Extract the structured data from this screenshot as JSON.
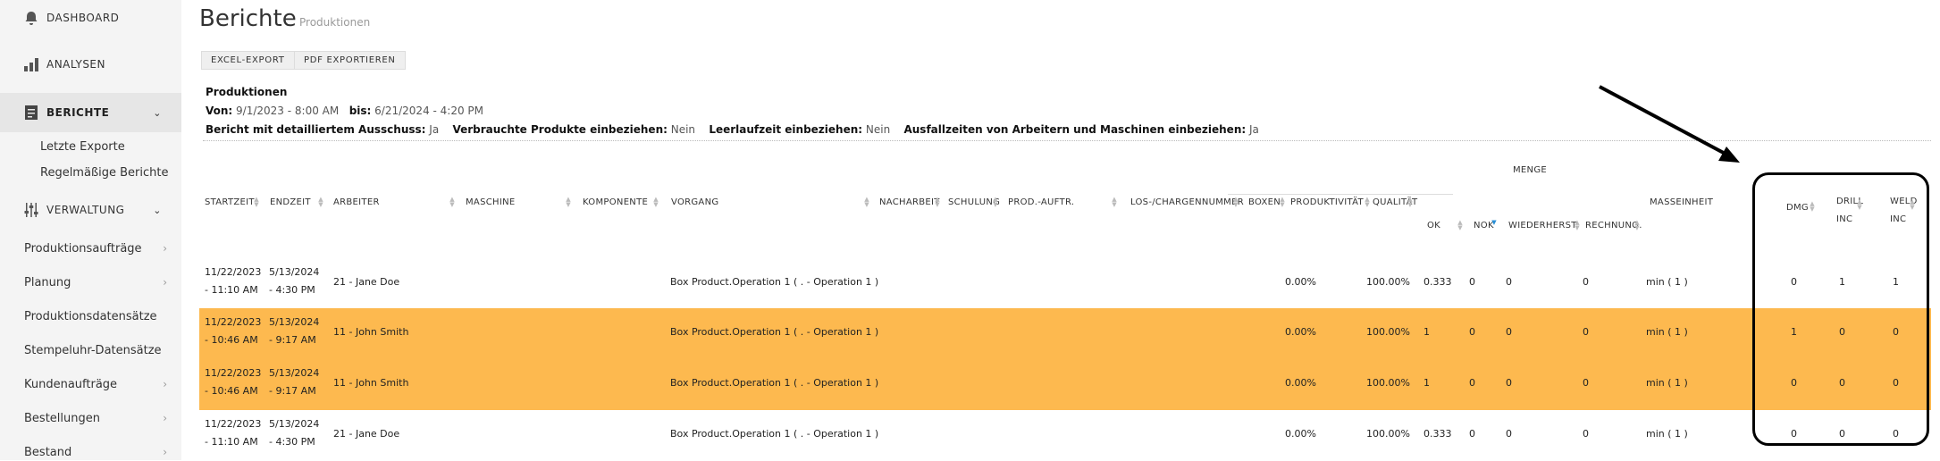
{
  "sidebar": {
    "dashboard": "DASHBOARD",
    "analysen": "ANALYSEN",
    "berichte": "BERICHTE",
    "berichte_sub": [
      "Letzte Exporte",
      "Regelmäßige Berichte"
    ],
    "verwaltung": "VERWALTUNG",
    "items": [
      "Produktionsaufträge",
      "Planung",
      "Produktionsdatensätze",
      "Stempeluhr-Datensätze",
      "Kundenaufträge",
      "Bestellungen",
      "Bestand"
    ]
  },
  "header": {
    "title": "Berichte",
    "subtitle": "Produktionen"
  },
  "toolbar": {
    "excel": "EXCEL-EXPORT",
    "pdf": "PDF EXPORTIEREN"
  },
  "info": {
    "heading": "Produktionen",
    "von_label": "Von:",
    "von": "9/1/2023 - 8:00 AM",
    "bis_label": "bis:",
    "bis": "6/21/2024 - 4:20 PM",
    "opt1_label": "Bericht mit detailliertem Ausschuss:",
    "opt1": "Ja",
    "opt2_label": "Verbrauchte Produkte einbeziehen:",
    "opt2": "Nein",
    "opt3_label": "Leerlaufzeit einbeziehen:",
    "opt3": "Nein",
    "opt4_label": "Ausfallzeiten von Arbeitern und Maschinen einbeziehen:",
    "opt4": "Ja"
  },
  "table": {
    "group_menge": "MENGE",
    "columns": {
      "startzeit": "STARTZEIT",
      "endzeit": "ENDZEIT",
      "arbeiter": "ARBEITER",
      "maschine": "MASCHINE",
      "komponente": "KOMPONENTE",
      "vorgang": "VORGANG",
      "nacharbeit": "NACHARBEIT",
      "schulung": "SCHULUNG",
      "prod_auftr": "PROD.-AUFTR.",
      "los": "LOS-/CHARGENNUMMER",
      "boxen": "BOXEN",
      "produktivitaet": "PRODUKTIVITÄT",
      "qualitaet": "QUALITÄT",
      "ok": "OK",
      "nok": "NOK",
      "wiederherst": "WIEDERHERST.",
      "rechnung": "RECHNUNG.",
      "masseinheit": "MASSEINHEIT",
      "dmg": "DMG",
      "drill_1": "DRILL",
      "drill_2": "INC",
      "weld_1": "WELD",
      "weld_2": "INC"
    },
    "rows": [
      {
        "start1": "11/22/2023",
        "start2": "- 11:10 AM",
        "end1": "5/13/2024",
        "end2": "- 4:30 PM",
        "arbeiter": "21 - Jane Doe",
        "vorgang": "Box Product.Operation 1 ( . - Operation 1 )",
        "prod": "0.00%",
        "qual": "100.00%",
        "ok": "0.333",
        "nok": "0",
        "wied": "0",
        "rech": "0",
        "einheit": "min ( 1 )",
        "dmg": "0",
        "drill": "1",
        "weld": "1",
        "highlight": false
      },
      {
        "start1": "11/22/2023",
        "start2": "- 10:46 AM",
        "end1": "5/13/2024",
        "end2": "- 9:17 AM",
        "arbeiter": "11 - John Smith",
        "vorgang": "Box Product.Operation 1 ( . - Operation 1 )",
        "prod": "0.00%",
        "qual": "100.00%",
        "ok": "1",
        "nok": "0",
        "wied": "0",
        "rech": "0",
        "einheit": "min ( 1 )",
        "dmg": "1",
        "drill": "0",
        "weld": "0",
        "highlight": true
      },
      {
        "start1": "11/22/2023",
        "start2": "- 10:46 AM",
        "end1": "5/13/2024",
        "end2": "- 9:17 AM",
        "arbeiter": "11 - John Smith",
        "vorgang": "Box Product.Operation 1 ( . - Operation 1 )",
        "prod": "0.00%",
        "qual": "100.00%",
        "ok": "1",
        "nok": "0",
        "wied": "0",
        "rech": "0",
        "einheit": "min ( 1 )",
        "dmg": "0",
        "drill": "0",
        "weld": "0",
        "highlight": true
      },
      {
        "start1": "11/22/2023",
        "start2": "- 11:10 AM",
        "end1": "5/13/2024",
        "end2": "- 4:30 PM",
        "arbeiter": "21 - Jane Doe",
        "vorgang": "Box Product.Operation 1 ( . - Operation 1 )",
        "prod": "0.00%",
        "qual": "100.00%",
        "ok": "0.333",
        "nok": "0",
        "wied": "0",
        "rech": "0",
        "einheit": "min ( 1 )",
        "dmg": "0",
        "drill": "0",
        "weld": "0",
        "highlight": false
      }
    ]
  },
  "colors": {
    "highlight": "#fdb94f",
    "sidebar_bg": "#f4f4f4",
    "sort_active": "#2a8fd6"
  },
  "icons": [
    "bell-icon",
    "bar-chart-icon",
    "report-icon",
    "sliders-icon",
    "chevron-down-icon",
    "chevron-right-icon",
    "sort-icon"
  ]
}
